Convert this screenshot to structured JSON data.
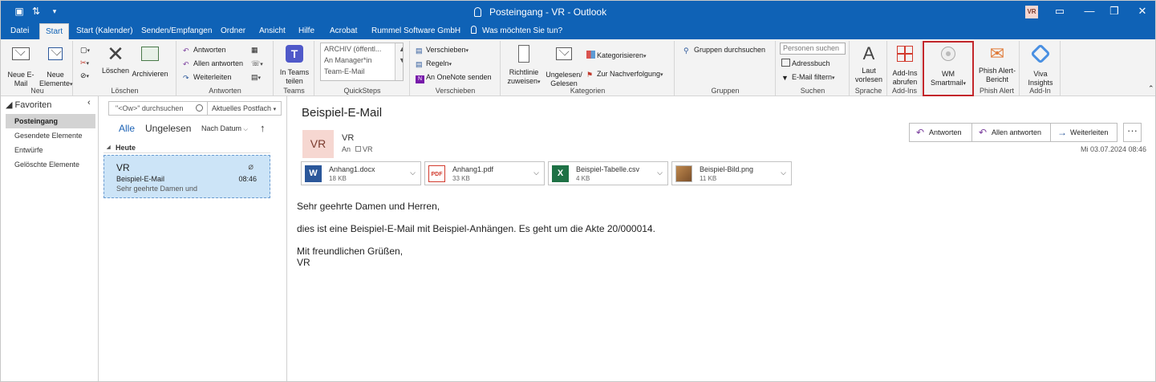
{
  "window": {
    "title": "Posteingang - VR - Outlook",
    "user_initials": "VR"
  },
  "tabs": [
    {
      "label": "Datei"
    },
    {
      "label": "Start"
    },
    {
      "label": "Start (Kalender)"
    },
    {
      "label": "Senden/Empfangen"
    },
    {
      "label": "Ordner"
    },
    {
      "label": "Ansicht"
    },
    {
      "label": "Hilfe"
    },
    {
      "label": "Acrobat"
    },
    {
      "label": "Rummel Software GmbH"
    }
  ],
  "tell_me": "Was möchten Sie tun?",
  "ribbon": {
    "neu": {
      "label": "Neu",
      "new_email": "Neue E-Mail",
      "new_items": "Neue Elemente"
    },
    "loeschen": {
      "label": "Löschen",
      "delete": "Löschen",
      "archive": "Archivieren"
    },
    "antworten": {
      "label": "Antworten",
      "reply": "Antworten",
      "reply_all": "Allen antworten",
      "forward": "Weiterleiten"
    },
    "teams": {
      "label": "Teams",
      "share": "In Teams teilen"
    },
    "quicksteps": {
      "label": "QuickSteps",
      "items": [
        "ARCHIV (öffentl...",
        "An Manager*in",
        "Team-E-Mail"
      ]
    },
    "verschieben": {
      "label": "Verschieben",
      "move": "Verschieben",
      "rules": "Regeln",
      "onenote": "An OneNote senden"
    },
    "kategorien": {
      "label": "Kategorien",
      "policy": "Richtlinie zuweisen",
      "unread_read": "Ungelesen/ Gelesen",
      "categorize": "Kategorisieren",
      "followup": "Zur Nachverfolgung"
    },
    "gruppen": {
      "label": "Gruppen",
      "browse": "Gruppen durchsuchen"
    },
    "suchen": {
      "label": "Suchen",
      "search_people": "Personen suchen",
      "address_book": "Adressbuch",
      "filter": "E-Mail filtern"
    },
    "sprache": {
      "label": "Sprache",
      "read_aloud": "Laut vorlesen"
    },
    "addins": {
      "label": "Add-Ins",
      "get_addins": "Add-Ins abrufen"
    },
    "wm": {
      "label": "WM Smartmail"
    },
    "phish": {
      "label": "Phish Alert",
      "report": "Phish Alert- Bericht"
    },
    "addin": {
      "label": "Add-In",
      "viva": "Viva Insights"
    }
  },
  "nav": {
    "favorites": "Favoriten",
    "items": [
      "Posteingang",
      "Gesendete Elemente",
      "Entwürfe",
      "Gelöschte Elemente"
    ]
  },
  "list": {
    "search_placeholder": "\"<Ow>\" durchsuchen",
    "scope": "Aktuelles Postfach",
    "filter_all": "Alle",
    "filter_unread": "Ungelesen",
    "sort": "Nach Datum",
    "group": "Heute",
    "mail": {
      "from": "VR",
      "subject": "Beispiel-E-Mail",
      "preview": "Sehr geehrte Damen und",
      "time": "08:46"
    }
  },
  "reading": {
    "subject": "Beispiel-E-Mail",
    "sender_initials": "VR",
    "sender_name": "VR",
    "to_label": "An",
    "to_value": "VR",
    "actions": {
      "reply": "Antworten",
      "reply_all": "Allen antworten",
      "forward": "Weiterleiten",
      "more": "···"
    },
    "date": "Mi 03.07.2024 08:46",
    "attachments": [
      {
        "name": "Anhang1.docx",
        "size": "18 KB",
        "type": "word"
      },
      {
        "name": "Anhang1.pdf",
        "size": "33 KB",
        "type": "pdf"
      },
      {
        "name": "Beispiel-Tabelle.csv",
        "size": "4 KB",
        "type": "excel"
      },
      {
        "name": "Beispiel-Bild.png",
        "size": "11 KB",
        "type": "image"
      }
    ],
    "body": [
      "Sehr geehrte Damen und Herren,",
      "dies ist eine Beispiel-E-Mail mit Beispiel-Anhängen. Es geht um die Akte 20/000014.",
      "Mit freundlichen Grüßen,",
      "VR"
    ]
  }
}
